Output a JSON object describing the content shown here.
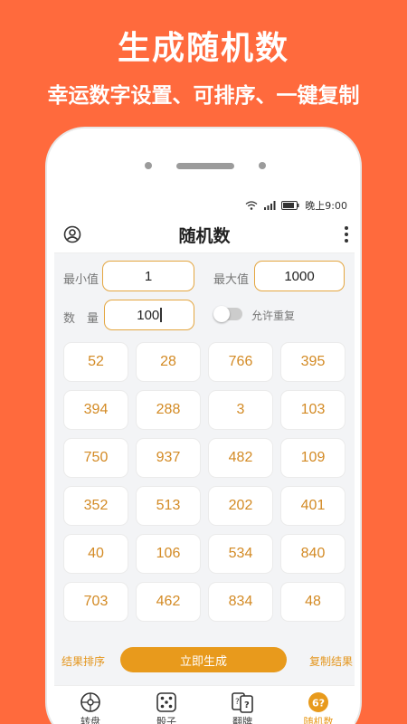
{
  "promo": {
    "title": "生成随机数",
    "subtitle": "幸运数字设置、可排序、一键复制"
  },
  "statusbar": {
    "time": "晚上9:00"
  },
  "appbar": {
    "title": "随机数"
  },
  "form": {
    "min_label": "最小值",
    "min_value": "1",
    "max_label": "最大值",
    "max_value": "1000",
    "count_label": "数　量",
    "count_value": "100",
    "repeat_label": "允许重复",
    "repeat_enabled": false
  },
  "results": [
    "52",
    "28",
    "766",
    "395",
    "394",
    "288",
    "3",
    "103",
    "750",
    "937",
    "482",
    "109",
    "352",
    "513",
    "202",
    "401",
    "40",
    "106",
    "534",
    "840",
    "703",
    "462",
    "834",
    "48"
  ],
  "actions": {
    "sort_label": "结果排序",
    "generate_label": "立即生成",
    "copy_label": "复制结果"
  },
  "tabs": [
    {
      "label": "转盘",
      "icon": "wheel-icon"
    },
    {
      "label": "骰子",
      "icon": "dice-icon"
    },
    {
      "label": "翻牌",
      "icon": "card-flip-icon"
    },
    {
      "label": "随机数",
      "icon": "random-number-icon",
      "active": true
    }
  ],
  "colors": {
    "background": "#FF6A3D",
    "accent": "#E89A1C",
    "number": "#D38A24"
  }
}
